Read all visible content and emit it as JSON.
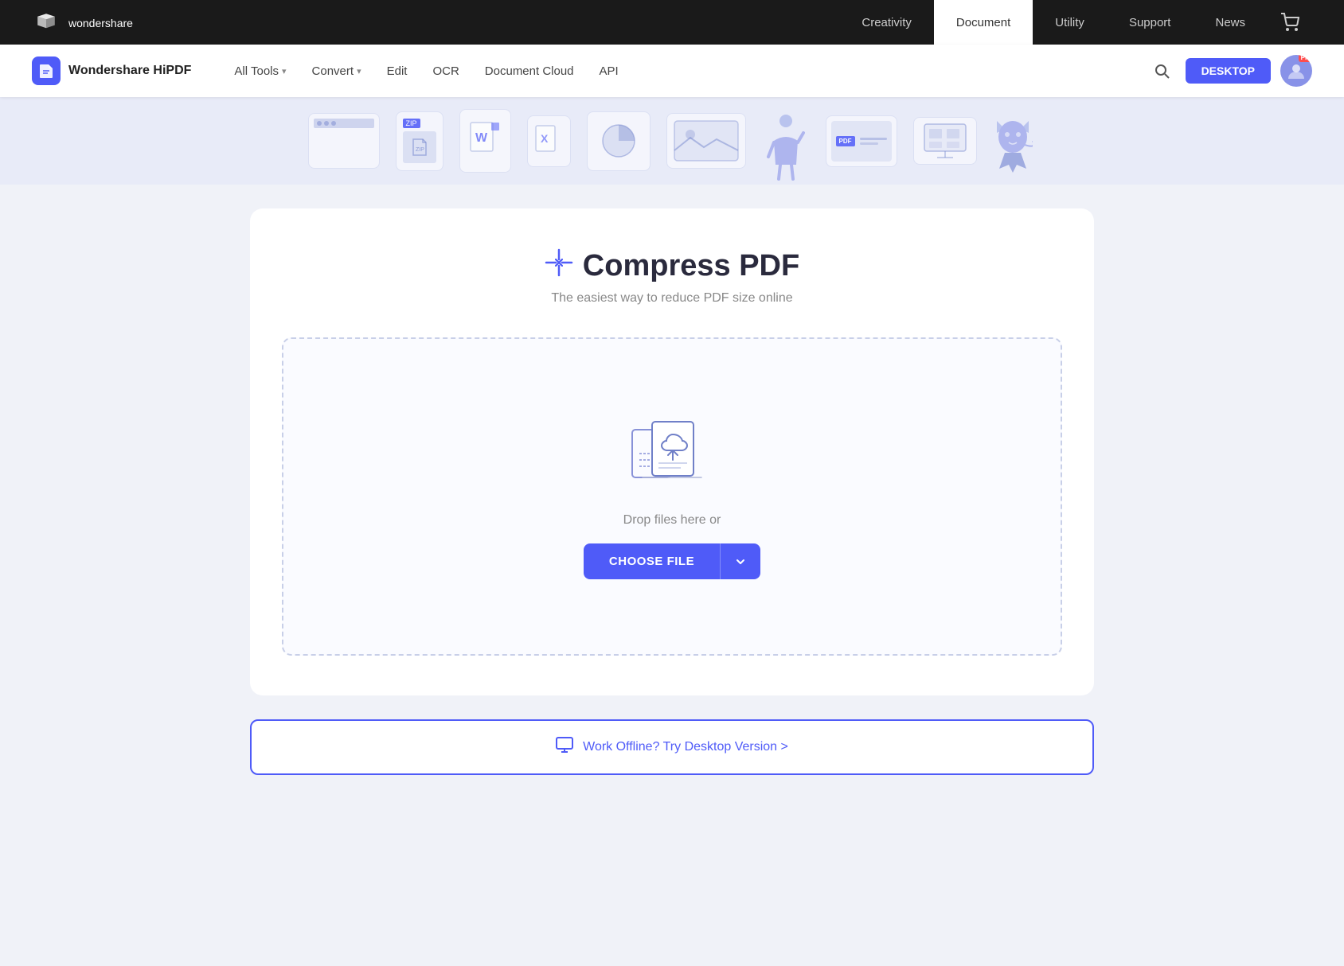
{
  "topNav": {
    "logoAlt": "Wondershare",
    "links": [
      {
        "label": "Creativity",
        "active": false
      },
      {
        "label": "Document",
        "active": true
      },
      {
        "label": "Utility",
        "active": false
      },
      {
        "label": "Support",
        "active": false
      },
      {
        "label": "News",
        "active": false
      }
    ],
    "cartIcon": "🛒"
  },
  "subNav": {
    "logoText": "Wondershare HiPDF",
    "items": [
      {
        "label": "All Tools",
        "hasDropdown": true
      },
      {
        "label": "Convert",
        "hasDropdown": true
      },
      {
        "label": "Edit",
        "hasDropdown": false
      },
      {
        "label": "OCR",
        "hasDropdown": false
      },
      {
        "label": "Document Cloud",
        "hasDropdown": false
      },
      {
        "label": "API",
        "hasDropdown": false
      }
    ],
    "desktopBtn": "DESKTOP",
    "proLabel": "Pro"
  },
  "page": {
    "title": "Compress PDF",
    "subtitle": "The easiest way to reduce PDF size online",
    "dropText": "Drop files here or",
    "chooseFileBtn": "CHOOSE FILE",
    "offlineText": "Work Offline? Try Desktop Version >"
  },
  "colors": {
    "brand": "#4f5bf8",
    "navDark": "#1a1a1a",
    "bannerBg": "#e8ebf8"
  }
}
